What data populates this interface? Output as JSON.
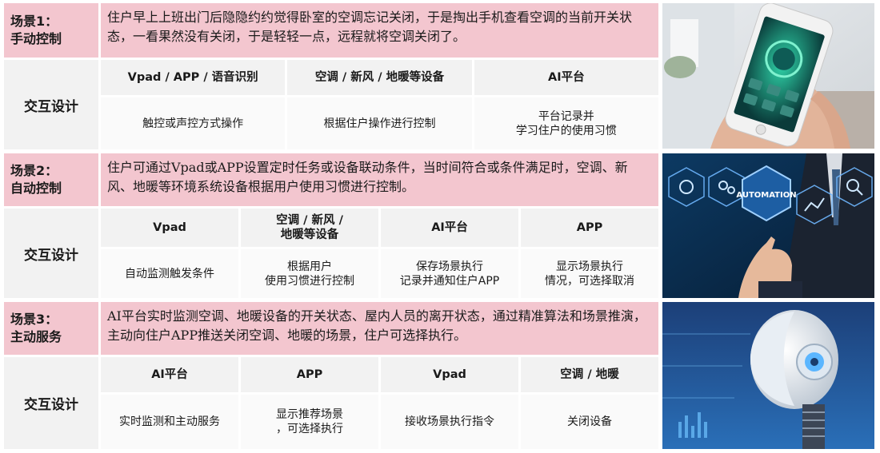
{
  "scenario1": {
    "label_line1": "场景1：",
    "label_line2": "手动控制",
    "desc": "住户早上上班出门后隐隐约约觉得卧室的空调忘记关闭，于是掏出手机查看空调的当前开关状态，一看果然没有关闭，于是轻轻一点，远程就将空调关闭了。"
  },
  "interaction1": {
    "label": "交互设计",
    "headers": [
      "Vpad / APP / 语音识别",
      "空调 / 新风 / 地暖等设备",
      "AI平台"
    ],
    "cells": [
      "触控或声控方式操作",
      "根据住户操作进行控制",
      "平台记录并\n学习住户的使用习惯"
    ]
  },
  "scenario2": {
    "label_line1": "场景2：",
    "label_line2": "自动控制",
    "desc": "住户可通过Vpad或APP设置定时任务或设备联动条件，当时间符合或条件满足时，空调、新风、地暖等环境系统设备根据用户使用习惯进行控制。"
  },
  "interaction2": {
    "label": "交互设计",
    "headers": [
      "Vpad",
      "空调 / 新风 /\n地暖等设备",
      "AI平台",
      "APP"
    ],
    "cells": [
      "自动监测触发条件",
      "根据用户\n使用习惯进行控制",
      "保存场景执行\n记录并通知住户APP",
      "显示场景执行\n情况，可选择取消"
    ]
  },
  "scenario3": {
    "label_line1": "场景3：",
    "label_line2": "主动服务",
    "desc": "AI平台实时监测空调、地暖设备的开关状态、屋内人员的离开状态，通过精准算法和场景推演，主动向住户APP推送关闭空调、地暖的场景，住户可选择执行。"
  },
  "interaction3": {
    "label": "交互设计",
    "headers": [
      "AI平台",
      "APP",
      "Vpad",
      "空调 / 地暖"
    ],
    "cells": [
      "实时监测和主动服务",
      "显示推荐场景\n，可选择执行",
      "接收场景执行指令",
      "关闭设备"
    ]
  },
  "images": {
    "automation_text": "AUTOMATION"
  }
}
